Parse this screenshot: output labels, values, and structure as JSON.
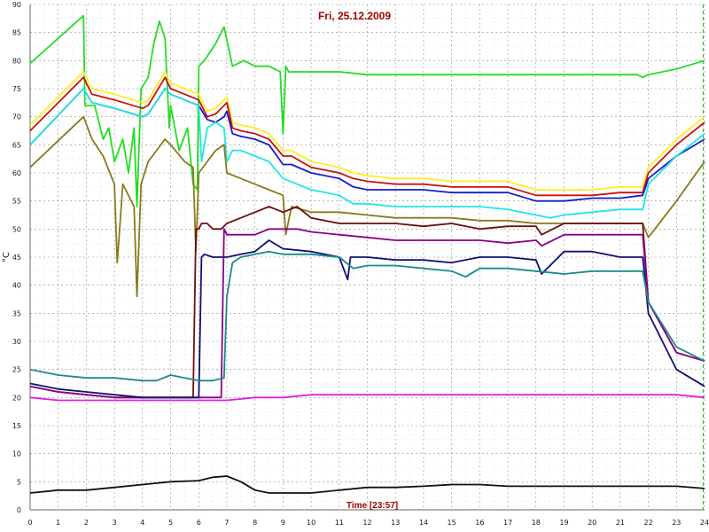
{
  "chart_data": {
    "type": "line",
    "title": "Fri, 25.12.2009",
    "xlabel": "Time [23:57]",
    "ylabel": "°C",
    "xlim": [
      0,
      24
    ],
    "ylim": [
      0,
      90
    ],
    "x_ticks": [
      "0",
      "1",
      "2",
      "3",
      "4",
      "5",
      "6",
      "7",
      "8",
      "9",
      "10",
      "11",
      "12",
      "13",
      "14",
      "15",
      "16",
      "17",
      "18",
      "19",
      "20",
      "21",
      "22",
      "23",
      "24"
    ],
    "y_ticks": [
      "0",
      "5",
      "10",
      "15",
      "20",
      "25",
      "30",
      "35",
      "40",
      "45",
      "50",
      "55",
      "60",
      "65",
      "70",
      "75",
      "80",
      "85",
      "90"
    ],
    "grid": true,
    "series": [
      {
        "color": "#22dd22",
        "x": [
          0,
          1.9,
          1.95,
          2.3,
          2.6,
          2.8,
          3.0,
          3.3,
          3.5,
          3.7,
          3.8,
          3.95,
          4.2,
          4.4,
          4.6,
          4.8,
          4.95,
          5.0,
          5.3,
          5.6,
          5.8,
          5.95,
          6.0,
          6.2,
          6.6,
          6.9,
          7.2,
          7.6,
          8.0,
          8.5,
          8.9,
          9.0,
          9.1,
          9.2,
          10,
          11,
          12,
          13,
          14,
          15,
          16,
          17,
          18,
          19,
          20,
          21,
          21.6,
          21.8,
          22,
          23,
          24
        ],
        "y": [
          79.5,
          88,
          72,
          72,
          66,
          68,
          62,
          66,
          60,
          68,
          54,
          75,
          77,
          83,
          87,
          84,
          68,
          72,
          64,
          68,
          58,
          57,
          79,
          80,
          83,
          86,
          79,
          80,
          79,
          79,
          78,
          67,
          79,
          78,
          78,
          78,
          77.5,
          77.5,
          77.5,
          77.5,
          77.5,
          77.5,
          77.5,
          77.5,
          77.5,
          77.5,
          77.5,
          77,
          77.5,
          78.5,
          80
        ]
      },
      {
        "color": "#ffee22",
        "x": [
          0,
          1.9,
          2.2,
          3,
          4,
          4.2,
          4.8,
          5,
          5.5,
          6,
          6.3,
          6.6,
          6.9,
          7.0,
          7.2,
          7.5,
          8,
          8.5,
          9,
          9.3,
          10,
          11,
          11.5,
          12,
          13,
          14,
          15,
          16,
          17,
          18,
          19,
          20,
          21,
          21.8,
          22,
          23,
          24
        ],
        "y": [
          68.5,
          78,
          75,
          74,
          72.5,
          73,
          78,
          76,
          75,
          74,
          71,
          71.5,
          73,
          73.5,
          69,
          68.5,
          68,
          67,
          64,
          64,
          62,
          61,
          60,
          59.5,
          59,
          59,
          58.5,
          58.5,
          58.5,
          57,
          57,
          57,
          57.5,
          57.5,
          61,
          66,
          70
        ]
      },
      {
        "color": "#cc1111",
        "x": [
          0,
          1.9,
          2.2,
          3,
          4,
          4.2,
          4.8,
          5,
          5.5,
          6,
          6.3,
          6.6,
          6.9,
          7.0,
          7.2,
          7.5,
          8,
          8.5,
          9,
          9.3,
          10,
          11,
          11.5,
          12,
          13,
          14,
          15,
          16,
          17,
          18,
          19,
          20,
          21,
          21.8,
          22,
          23,
          24
        ],
        "y": [
          67.5,
          77,
          74,
          73,
          71.5,
          72,
          77,
          75,
          74,
          73,
          70,
          70.5,
          72,
          72.5,
          68,
          67.5,
          67,
          66,
          63,
          63,
          61,
          60,
          59,
          58.5,
          58,
          58,
          57.5,
          57.5,
          57.5,
          56,
          56,
          56,
          56.5,
          56.5,
          60,
          65,
          69
        ]
      },
      {
        "color": "#1a1acc",
        "x": [
          0,
          1.9,
          2.2,
          3,
          4,
          4.2,
          4.8,
          5,
          5.5,
          6,
          6.3,
          6.6,
          6.9,
          7.0,
          7.2,
          7.5,
          8,
          8.5,
          9,
          9.3,
          10,
          11,
          11.5,
          12,
          13,
          14,
          15,
          16,
          17,
          18,
          19,
          20,
          21,
          21.8,
          22,
          23,
          24
        ],
        "y": [
          65,
          75,
          72.5,
          71.5,
          70,
          70.5,
          75,
          74,
          73,
          72,
          69.5,
          69,
          70,
          71,
          67,
          66.5,
          66,
          65,
          61.5,
          61.5,
          60,
          59,
          57.5,
          57,
          57,
          57,
          56.5,
          56.5,
          56.5,
          55,
          55,
          55.5,
          55.5,
          56,
          59,
          63,
          66
        ]
      },
      {
        "color": "#22e5e5",
        "x": [
          0,
          1.9,
          2.2,
          3,
          4,
          4.2,
          4.8,
          5,
          5.5,
          6,
          6.1,
          6.3,
          6.6,
          6.9,
          7.0,
          7.2,
          7.5,
          8,
          8.5,
          9,
          10,
          11,
          11.5,
          12,
          13,
          14,
          15,
          16,
          17,
          18,
          18.5,
          19,
          20,
          21,
          21.8,
          22,
          23,
          24
        ],
        "y": [
          65,
          75,
          72.5,
          71.5,
          70,
          70.5,
          75,
          74,
          73,
          72,
          62,
          68,
          69,
          68,
          62,
          64,
          64,
          63,
          62,
          59,
          57,
          56,
          54.5,
          54.5,
          54,
          54,
          54,
          54,
          53.5,
          52.5,
          52,
          52.5,
          53,
          53.5,
          53.5,
          58,
          63,
          67
        ]
      },
      {
        "color": "#8a7a1a",
        "x": [
          0,
          1.9,
          2.2,
          2.6,
          3.0,
          3.1,
          3.3,
          3.7,
          3.8,
          3.95,
          4.2,
          4.8,
          5.0,
          5.5,
          5.8,
          5.9,
          6.0,
          6.3,
          6.6,
          6.9,
          7.0,
          7.5,
          8,
          8.5,
          9.0,
          9.1,
          9.3,
          10,
          11,
          12,
          13,
          14,
          15,
          16,
          17,
          18,
          19,
          20,
          21,
          21.8,
          22,
          23,
          24
        ],
        "y": [
          61,
          70,
          66,
          63,
          58,
          44,
          58,
          54,
          38,
          58,
          62,
          66,
          65,
          62,
          61,
          46,
          60,
          62,
          64,
          65,
          60,
          59,
          58,
          57,
          56,
          49,
          54,
          53,
          53,
          52.5,
          52,
          52,
          52,
          51.5,
          51.5,
          51,
          51,
          51,
          51,
          51,
          48.5,
          55,
          62
        ]
      },
      {
        "color": "#6b0f0f",
        "x": [
          0,
          1,
          2,
          3,
          4,
          5,
          5.8,
          5.9,
          6,
          6.1,
          6.3,
          6.5,
          6.8,
          7,
          7.5,
          8,
          8.5,
          9,
          9.5,
          10,
          11,
          12,
          13,
          14,
          15,
          16,
          17,
          18,
          18.2,
          19,
          20,
          21,
          21.8,
          22,
          23,
          24
        ],
        "y": [
          22,
          21,
          20.5,
          20,
          20,
          20,
          20,
          50,
          50,
          51,
          51,
          50,
          50,
          51,
          52,
          53,
          54,
          53,
          54,
          52,
          51,
          51,
          51,
          50.5,
          51,
          50,
          50.5,
          50.5,
          49,
          51,
          51,
          51,
          51,
          37,
          28,
          26.5
        ]
      },
      {
        "color": "#880088",
        "x": [
          0,
          1,
          2,
          3,
          4,
          5,
          6,
          6.8,
          6.9,
          7,
          7.5,
          8,
          8.5,
          9,
          9.5,
          10,
          11,
          12,
          13,
          14,
          15,
          16,
          17,
          18,
          18.2,
          19,
          20,
          21,
          21.8,
          22,
          23,
          24
        ],
        "y": [
          22,
          21,
          20.5,
          20,
          20,
          20,
          20,
          20,
          50,
          49,
          49,
          49,
          50,
          50,
          50,
          49.5,
          49,
          48.5,
          48,
          48,
          48,
          48,
          47.5,
          48,
          47,
          49,
          49,
          49,
          49,
          37,
          28,
          26.5
        ]
      },
      {
        "color": "#101070",
        "x": [
          0,
          1,
          2,
          3,
          4,
          5,
          6,
          6.1,
          6.2,
          6.5,
          7,
          7.5,
          8,
          8.5,
          9,
          10,
          11,
          11.3,
          11.4,
          12,
          13,
          14,
          15,
          16,
          17,
          18,
          18.2,
          19,
          20,
          21,
          21.8,
          22,
          23,
          24
        ],
        "y": [
          22.5,
          21.5,
          21,
          20.5,
          20,
          20,
          20,
          45,
          45.5,
          45,
          45,
          45.5,
          46,
          48,
          46.5,
          46,
          45,
          41,
          45,
          45,
          44.5,
          44.5,
          44,
          45,
          45,
          44.5,
          42,
          46,
          46,
          45,
          45,
          35,
          25,
          22
        ]
      },
      {
        "color": "#1a8a8a",
        "x": [
          0,
          1,
          2,
          3,
          4,
          4.5,
          5,
          5.5,
          6,
          6.5,
          6.9,
          7.0,
          7.2,
          7.5,
          8,
          8.5,
          9,
          10,
          11,
          11.5,
          12,
          13,
          14,
          15,
          15.5,
          16,
          17,
          18,
          19,
          20,
          21,
          21.8,
          22,
          23,
          24
        ],
        "y": [
          25,
          24,
          23.5,
          23.5,
          23,
          23,
          24,
          23.5,
          23,
          23,
          23.5,
          38,
          44,
          45,
          45.5,
          46,
          45.5,
          45.5,
          45,
          43,
          43.5,
          43.5,
          43,
          42.5,
          41.5,
          43,
          43,
          42.5,
          42,
          42.5,
          42.5,
          42.5,
          37,
          29,
          26.5
        ]
      },
      {
        "color": "#dd22dd",
        "x": [
          0,
          1,
          2,
          3,
          4,
          5,
          6,
          7,
          8,
          9,
          10,
          11,
          12,
          13,
          14,
          15,
          16,
          17,
          18,
          19,
          20,
          21,
          22,
          23,
          24
        ],
        "y": [
          20,
          19.5,
          19.5,
          19.5,
          19.5,
          19.5,
          19.5,
          19.5,
          20,
          20,
          20.5,
          20.5,
          20.5,
          20.5,
          20.5,
          20.5,
          20.5,
          20.5,
          20.5,
          20.5,
          20.5,
          20.5,
          20.5,
          20.5,
          20
        ]
      },
      {
        "color": "#111111",
        "x": [
          0,
          1,
          2,
          3,
          4,
          5,
          6,
          6.5,
          7,
          7.5,
          8,
          8.5,
          9,
          10,
          11,
          12,
          13,
          14,
          15,
          16,
          17,
          18,
          19,
          20,
          21,
          22,
          23,
          24
        ],
        "y": [
          3,
          3.5,
          3.5,
          4,
          4.5,
          5,
          5.2,
          5.8,
          6,
          5,
          3.5,
          3,
          3,
          3,
          3.5,
          4,
          4,
          4.2,
          4.5,
          4.5,
          4.2,
          4.2,
          4.2,
          4.2,
          4.2,
          4.2,
          4.2,
          3.8
        ]
      }
    ]
  }
}
